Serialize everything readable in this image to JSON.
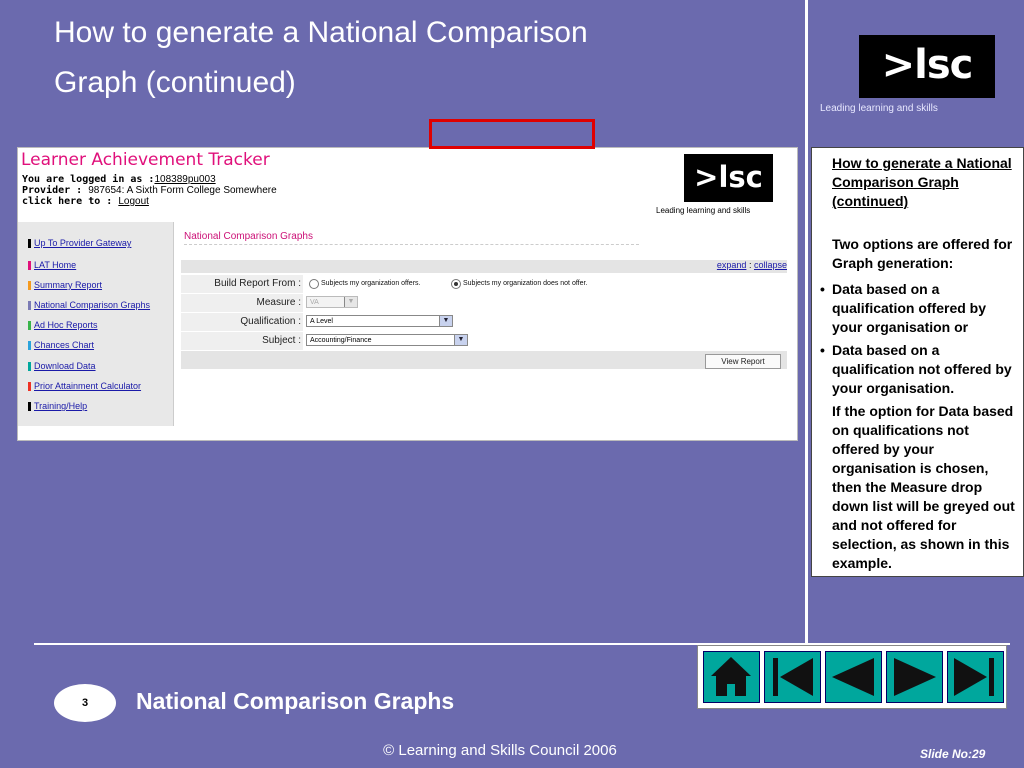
{
  "slide": {
    "title_line1": "How to generate a National Comparison",
    "title_line2": "Graph (continued)",
    "logo_text": ">lsc",
    "logo_tagline": "Leading learning and skills",
    "section": "National Comparison Graphs",
    "number": "3",
    "copyright": "© Learning and Skills Council 2006",
    "slide_no": "Slide No:29"
  },
  "screenshot": {
    "app_title": "Learner Achievement Tracker",
    "logged_in_label": "You are logged in as :",
    "logged_in_user": "108389pu003",
    "provider_label": "Provider :",
    "provider_value": "987654: A Sixth Form College Somewhere",
    "click_label": "click here to :",
    "logout": "Logout",
    "logo_text": ">lsc",
    "logo_tagline": "Leading learning and skills",
    "nav": [
      {
        "label": "Up To Provider Gateway",
        "color": "#000000"
      },
      {
        "label": "LAT Home",
        "color": "#e0107b"
      },
      {
        "label": "Summary Report",
        "color": "#f59a1e"
      },
      {
        "label": "National Comparison Graphs",
        "color": "#7b7bb5"
      },
      {
        "label": "Ad Hoc Reports",
        "color": "#39b54a"
      },
      {
        "label": "Chances Chart",
        "color": "#2aa3dc"
      },
      {
        "label": "Download Data",
        "color": "#00a79d"
      },
      {
        "label": "Prior Attainment Calculator",
        "color": "#ee3124"
      },
      {
        "label": "Training/Help",
        "color": "#000000"
      }
    ],
    "section_heading": "National Comparison Graphs",
    "expand": "expand",
    "separator": ":",
    "collapse": "collapse",
    "form": {
      "build_label": "Build Report From :",
      "option1": "Subjects my organization offers.",
      "option2": "Subjects my organization does not offer.",
      "measure_label": "Measure :",
      "measure_value": "VA",
      "qualification_label": "Qualification :",
      "qualification_value": "A Level",
      "subject_label": "Subject :",
      "subject_value": "Accounting/Finance",
      "view_report": "View Report"
    }
  },
  "info": {
    "title": "How to generate a National Comparison Graph (continued)",
    "intro": "Two options are offered for Graph generation:",
    "bullet_char": "•",
    "bullet1": "Data based on a qualification offered by your organisation or",
    "bullet2": "Data based on a qualification not offered by your organisation.",
    "body": "If the option for Data based on qualifications not offered by your organisation is chosen, then the Measure drop down list will be greyed out and not offered for selection, as shown in this example."
  }
}
